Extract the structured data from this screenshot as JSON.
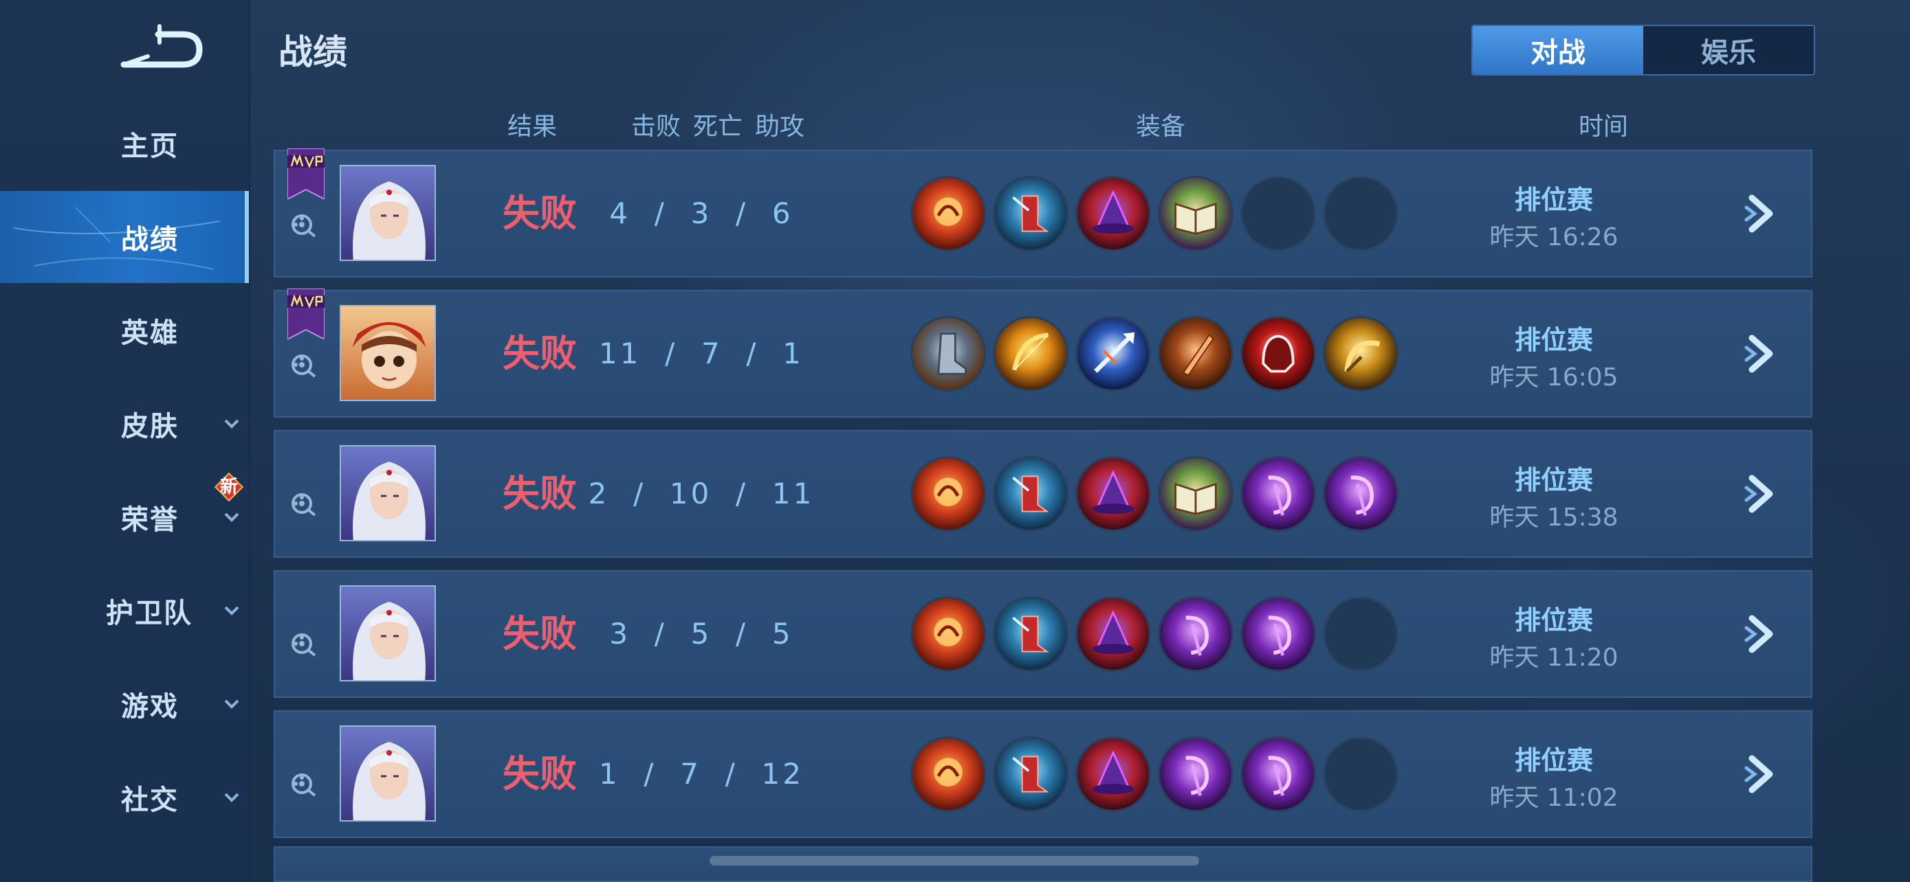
{
  "header": {
    "title": "战绩",
    "tabs": [
      {
        "label": "对战",
        "active": true
      },
      {
        "label": "娱乐",
        "active": false
      }
    ]
  },
  "columns": {
    "result": "结果",
    "kills": "击败",
    "deaths": "死亡",
    "assists": "助攻",
    "equipment": "装备",
    "time": "时间"
  },
  "sidebar": {
    "items": [
      {
        "label": "主页",
        "active": false,
        "dropdown": false
      },
      {
        "label": "战绩",
        "active": true,
        "dropdown": false
      },
      {
        "label": "英雄",
        "active": false,
        "dropdown": false
      },
      {
        "label": "皮肤",
        "active": false,
        "dropdown": true
      },
      {
        "label": "荣誉",
        "active": false,
        "dropdown": true,
        "badge": "新"
      },
      {
        "label": "护卫队",
        "active": false,
        "dropdown": true
      },
      {
        "label": "游戏",
        "active": false,
        "dropdown": true
      },
      {
        "label": "社交",
        "active": false,
        "dropdown": true
      }
    ]
  },
  "matches": [
    {
      "mvp": true,
      "hero": "white-haired-mage",
      "result": "失败",
      "kda": "4  /  3  /  6",
      "items": [
        "flame-orb",
        "ice-boots",
        "wizard-hat",
        "spell-book",
        "empty",
        "empty"
      ],
      "mode": "排位赛",
      "time": "昨天 16:26"
    },
    {
      "mvp": true,
      "hero": "monkey-girl",
      "result": "失败",
      "kda": "11  /  7  /  1",
      "items": [
        "steel-boots",
        "golden-bow",
        "blue-spear",
        "bronze-blade",
        "red-helm",
        "gold-scythe"
      ],
      "mode": "排位赛",
      "time": "昨天 16:05"
    },
    {
      "mvp": false,
      "hero": "white-haired-mage",
      "result": "失败",
      "kda": "2  /  10  /  11",
      "items": [
        "flame-orb",
        "ice-boots",
        "wizard-hat",
        "spell-book",
        "purple-staff",
        "purple-staff"
      ],
      "mode": "排位赛",
      "time": "昨天 15:38"
    },
    {
      "mvp": false,
      "hero": "white-haired-mage",
      "result": "失败",
      "kda": "3  /  5  /  5",
      "items": [
        "flame-orb",
        "ice-boots",
        "wizard-hat",
        "purple-staff",
        "purple-staff",
        "empty"
      ],
      "mode": "排位赛",
      "time": "昨天 11:20"
    },
    {
      "mvp": false,
      "hero": "white-haired-mage",
      "result": "失败",
      "kda": "1  /  7  /  12",
      "items": [
        "flame-orb",
        "ice-boots",
        "wizard-hat",
        "purple-staff",
        "purple-staff",
        "empty"
      ],
      "mode": "排位赛",
      "time": "昨天 11:02"
    }
  ],
  "colors": {
    "accent": "#2f76c8",
    "loss": "#ee5e6f",
    "mode": "#8fd0ff"
  }
}
